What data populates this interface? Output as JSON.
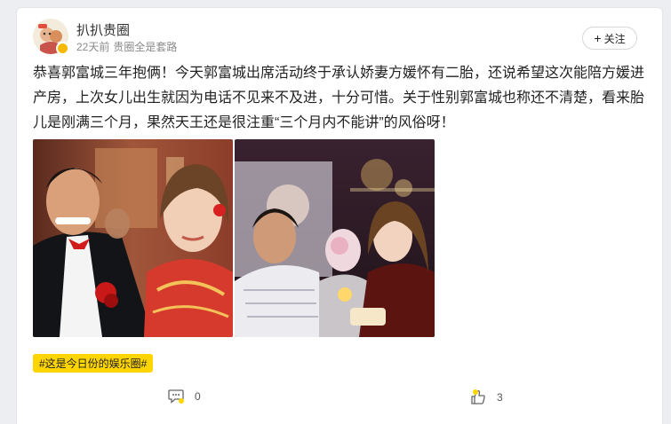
{
  "post": {
    "author": "扒扒贵圈",
    "time": "22天前",
    "source": "贵圈全是套路",
    "follow_label": "关注",
    "text": "恭喜郭富城三年抱俩！今天郭富城出席活动终于承认娇妻方媛怀有二胎，还说希望这次能陪方媛进产房，上次女儿出生就因为电话不见来不及进，十分可惜。关于性别郭富城也称还不清楚，看来胎儿是刚满三个月，果然天王还是很注重“三个月内不能讲”的风俗呀！",
    "tag": "#这是今日份的娱乐圈#",
    "comment_count": "0",
    "like_count": "3"
  },
  "icons": {
    "follow": "plus-icon",
    "comment": "comment-bubble-icon",
    "like": "thumbs-up-icon",
    "verified": "verified-badge-icon"
  },
  "colors": {
    "tag_background": "#ffd500",
    "verified_badge": "#f6b900",
    "page_background": "#eceef1"
  }
}
